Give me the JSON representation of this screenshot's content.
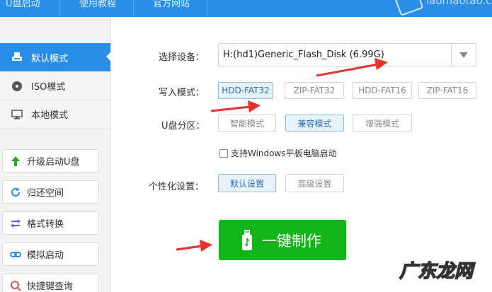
{
  "topbar": {
    "tabs": [
      "U盘启动",
      "使用教程",
      "官方网站"
    ],
    "site": "laomaotao.com"
  },
  "sidebar": {
    "modes": [
      {
        "label": "默认模式",
        "icon": "usb-drive-icon",
        "active": true
      },
      {
        "label": "ISO模式",
        "icon": "disc-icon",
        "active": false
      },
      {
        "label": "本地模式",
        "icon": "monitor-icon",
        "active": false
      }
    ],
    "tools": [
      {
        "label": "升级启动U盘",
        "icon": "upgrade-arrow-icon",
        "color": "#2ca62c"
      },
      {
        "label": "归还空间",
        "icon": "refresh-icon",
        "color": "#2a8ee6"
      },
      {
        "label": "格式转换",
        "icon": "convert-icon",
        "color": "#6a5acd"
      },
      {
        "label": "模拟启动",
        "icon": "link-icon",
        "color": "#2a8ee6"
      },
      {
        "label": "快捷键查询",
        "icon": "search-icon",
        "color": "#d9534f"
      }
    ]
  },
  "form": {
    "device_label": "选择设备：",
    "device_value": "H:(hd1)Generic_Flash_Disk (6.99G)",
    "write_mode_label": "写入模式：",
    "write_modes": [
      {
        "label": "HDD-FAT32",
        "selected": true
      },
      {
        "label": "ZIP-FAT32",
        "selected": false
      },
      {
        "label": "HDD-FAT16",
        "selected": false
      },
      {
        "label": "ZIP-FAT16",
        "selected": false
      }
    ],
    "partition_label": "U盘分区：",
    "partitions": [
      {
        "label": "智能模式",
        "selected": false
      },
      {
        "label": "兼容模式",
        "selected": true
      },
      {
        "label": "增强模式",
        "selected": false
      }
    ],
    "tablet_checkbox_label": "支持Windows平板电脑启动",
    "tablet_checked": false,
    "personalize_label": "个性化设置：",
    "personalize": [
      {
        "label": "默认设置",
        "selected": true
      },
      {
        "label": "高级设置",
        "selected": false
      }
    ],
    "make_button": "一键制作"
  },
  "watermark": "广东龙网",
  "colors": {
    "accent": "#2a8ee6",
    "go_button": "#12b41a",
    "arrow": "#e8312e"
  }
}
